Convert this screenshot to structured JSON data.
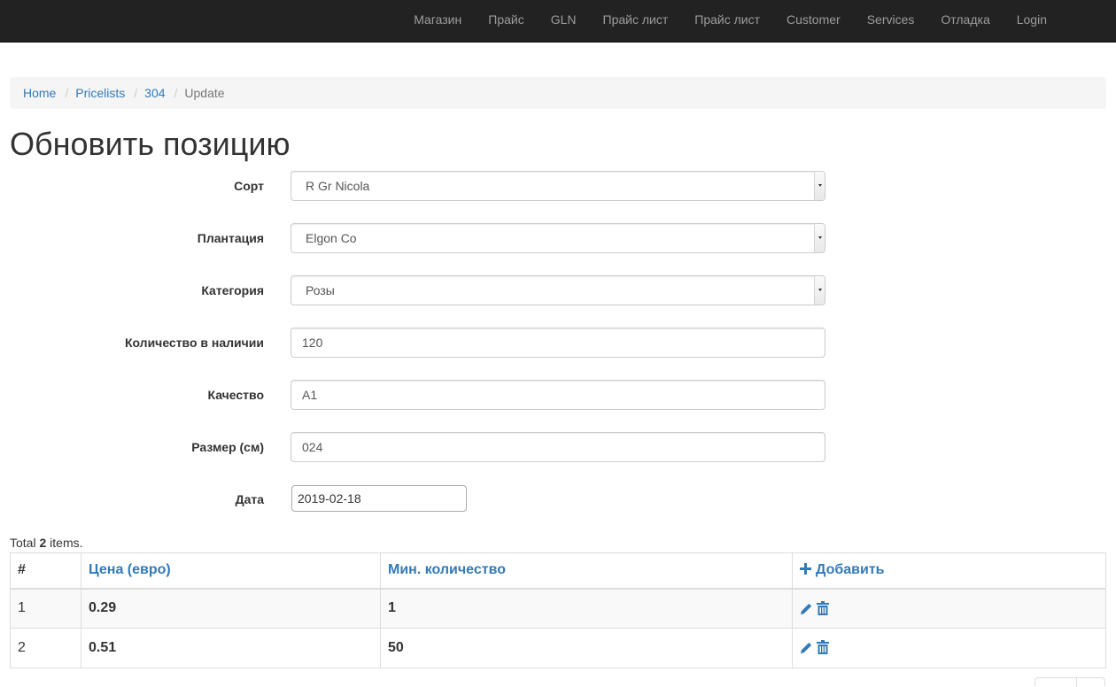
{
  "nav": {
    "items": [
      {
        "label": "Магазин"
      },
      {
        "label": "Прайс"
      },
      {
        "label": "GLN"
      },
      {
        "label": "Прайс лист"
      },
      {
        "label": "Прайс лист"
      },
      {
        "label": "Customer"
      },
      {
        "label": "Services"
      },
      {
        "label": "Отладка"
      },
      {
        "label": "Login"
      }
    ]
  },
  "breadcrumb": {
    "home": "Home",
    "pricelists": "Pricelists",
    "id": "304",
    "current": "Update",
    "separator": "/"
  },
  "page_title": "Обновить позицию",
  "form": {
    "sort": {
      "label": "Сорт",
      "value": "R Gr Nicola"
    },
    "plantation": {
      "label": "Плантация",
      "value": "Elgon Co"
    },
    "category": {
      "label": "Категория",
      "value": "Розы"
    },
    "stock": {
      "label": "Количество в наличии",
      "value": "120"
    },
    "quality": {
      "label": "Качество",
      "value": "A1"
    },
    "size": {
      "label": "Размер (см)",
      "value": "024"
    },
    "date": {
      "label": "Дата",
      "value": "2019-02-18"
    }
  },
  "summary": {
    "prefix": "Total ",
    "count": "2",
    "suffix": " items."
  },
  "table": {
    "headers": {
      "num": "#",
      "price": "Цена (евро)",
      "min_qty": "Мин. количество",
      "add": "Добавить"
    },
    "rows": [
      {
        "num": "1",
        "price": "0.29",
        "min_qty": "1"
      },
      {
        "num": "2",
        "price": "0.51",
        "min_qty": "50"
      }
    ]
  },
  "icons": {
    "add": "plus-icon",
    "edit": "pencil-icon",
    "delete": "trash-icon"
  },
  "colors": {
    "navbar": "#222222",
    "link": "#337ab7",
    "nav_text": "#9d9d9d",
    "breadcrumb_bg": "#f5f5f5"
  }
}
